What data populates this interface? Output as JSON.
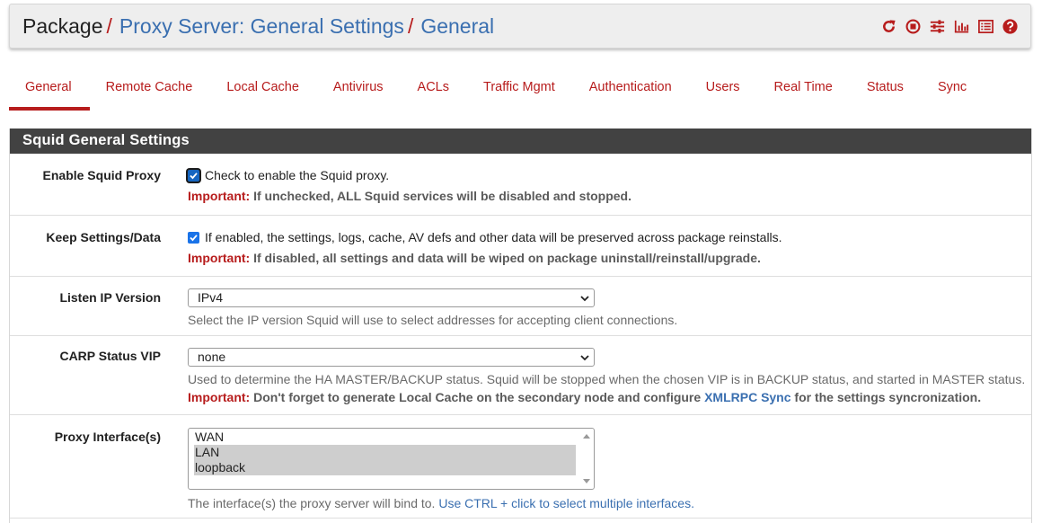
{
  "breadcrumb": {
    "root": "Package",
    "sep": "/",
    "items": [
      "Proxy Server: General Settings",
      "General"
    ]
  },
  "header_icons": [
    "reload-icon",
    "stop-icon",
    "sliders-icon",
    "bar-chart-icon",
    "log-list-icon",
    "help-icon"
  ],
  "colors": {
    "accent": "#b71c1c",
    "link": "#3a6fb0",
    "panel_heading_bg": "#424242"
  },
  "tabs": [
    {
      "label": "General",
      "active": true
    },
    {
      "label": "Remote Cache"
    },
    {
      "label": "Local Cache"
    },
    {
      "label": "Antivirus"
    },
    {
      "label": "ACLs"
    },
    {
      "label": "Traffic Mgmt"
    },
    {
      "label": "Authentication"
    },
    {
      "label": "Users"
    },
    {
      "label": "Real Time"
    },
    {
      "label": "Status"
    },
    {
      "label": "Sync"
    }
  ],
  "panel": {
    "title": "Squid General Settings",
    "enable": {
      "label": "Enable Squid Proxy",
      "checked": true,
      "text": "Check to enable the Squid proxy.",
      "important_prefix": "Important:",
      "important_text": " If unchecked, ALL Squid services will be disabled and stopped."
    },
    "keep": {
      "label": "Keep Settings/Data",
      "checked": true,
      "text": "If enabled, the settings, logs, cache, AV defs and other data will be preserved across package reinstalls.",
      "important_prefix": "Important:",
      "important_text": " If disabled, all settings and data will be wiped on package uninstall/reinstall/upgrade."
    },
    "listen": {
      "label": "Listen IP Version",
      "value": "IPv4",
      "help": "Select the IP version Squid will use to select addresses for accepting client connections."
    },
    "carp": {
      "label": "CARP Status VIP",
      "value": "none",
      "help": "Used to determine the HA MASTER/BACKUP status. Squid will be stopped when the chosen VIP is in BACKUP status, and started in MASTER status.",
      "important_prefix": "Important:",
      "important_text_1": " Don't forget to generate Local Cache on the secondary node and configure ",
      "important_link": "XMLRPC Sync",
      "important_text_2": " for the settings syncronization."
    },
    "interfaces": {
      "label": "Proxy Interface(s)",
      "options": [
        {
          "label": "WAN",
          "selected": false
        },
        {
          "label": "LAN",
          "selected": true
        },
        {
          "label": "loopback",
          "selected": true
        }
      ],
      "help_prefix": "The interface(s) the proxy server will bind to. ",
      "help_link": "Use CTRL + click to select multiple interfaces."
    }
  }
}
